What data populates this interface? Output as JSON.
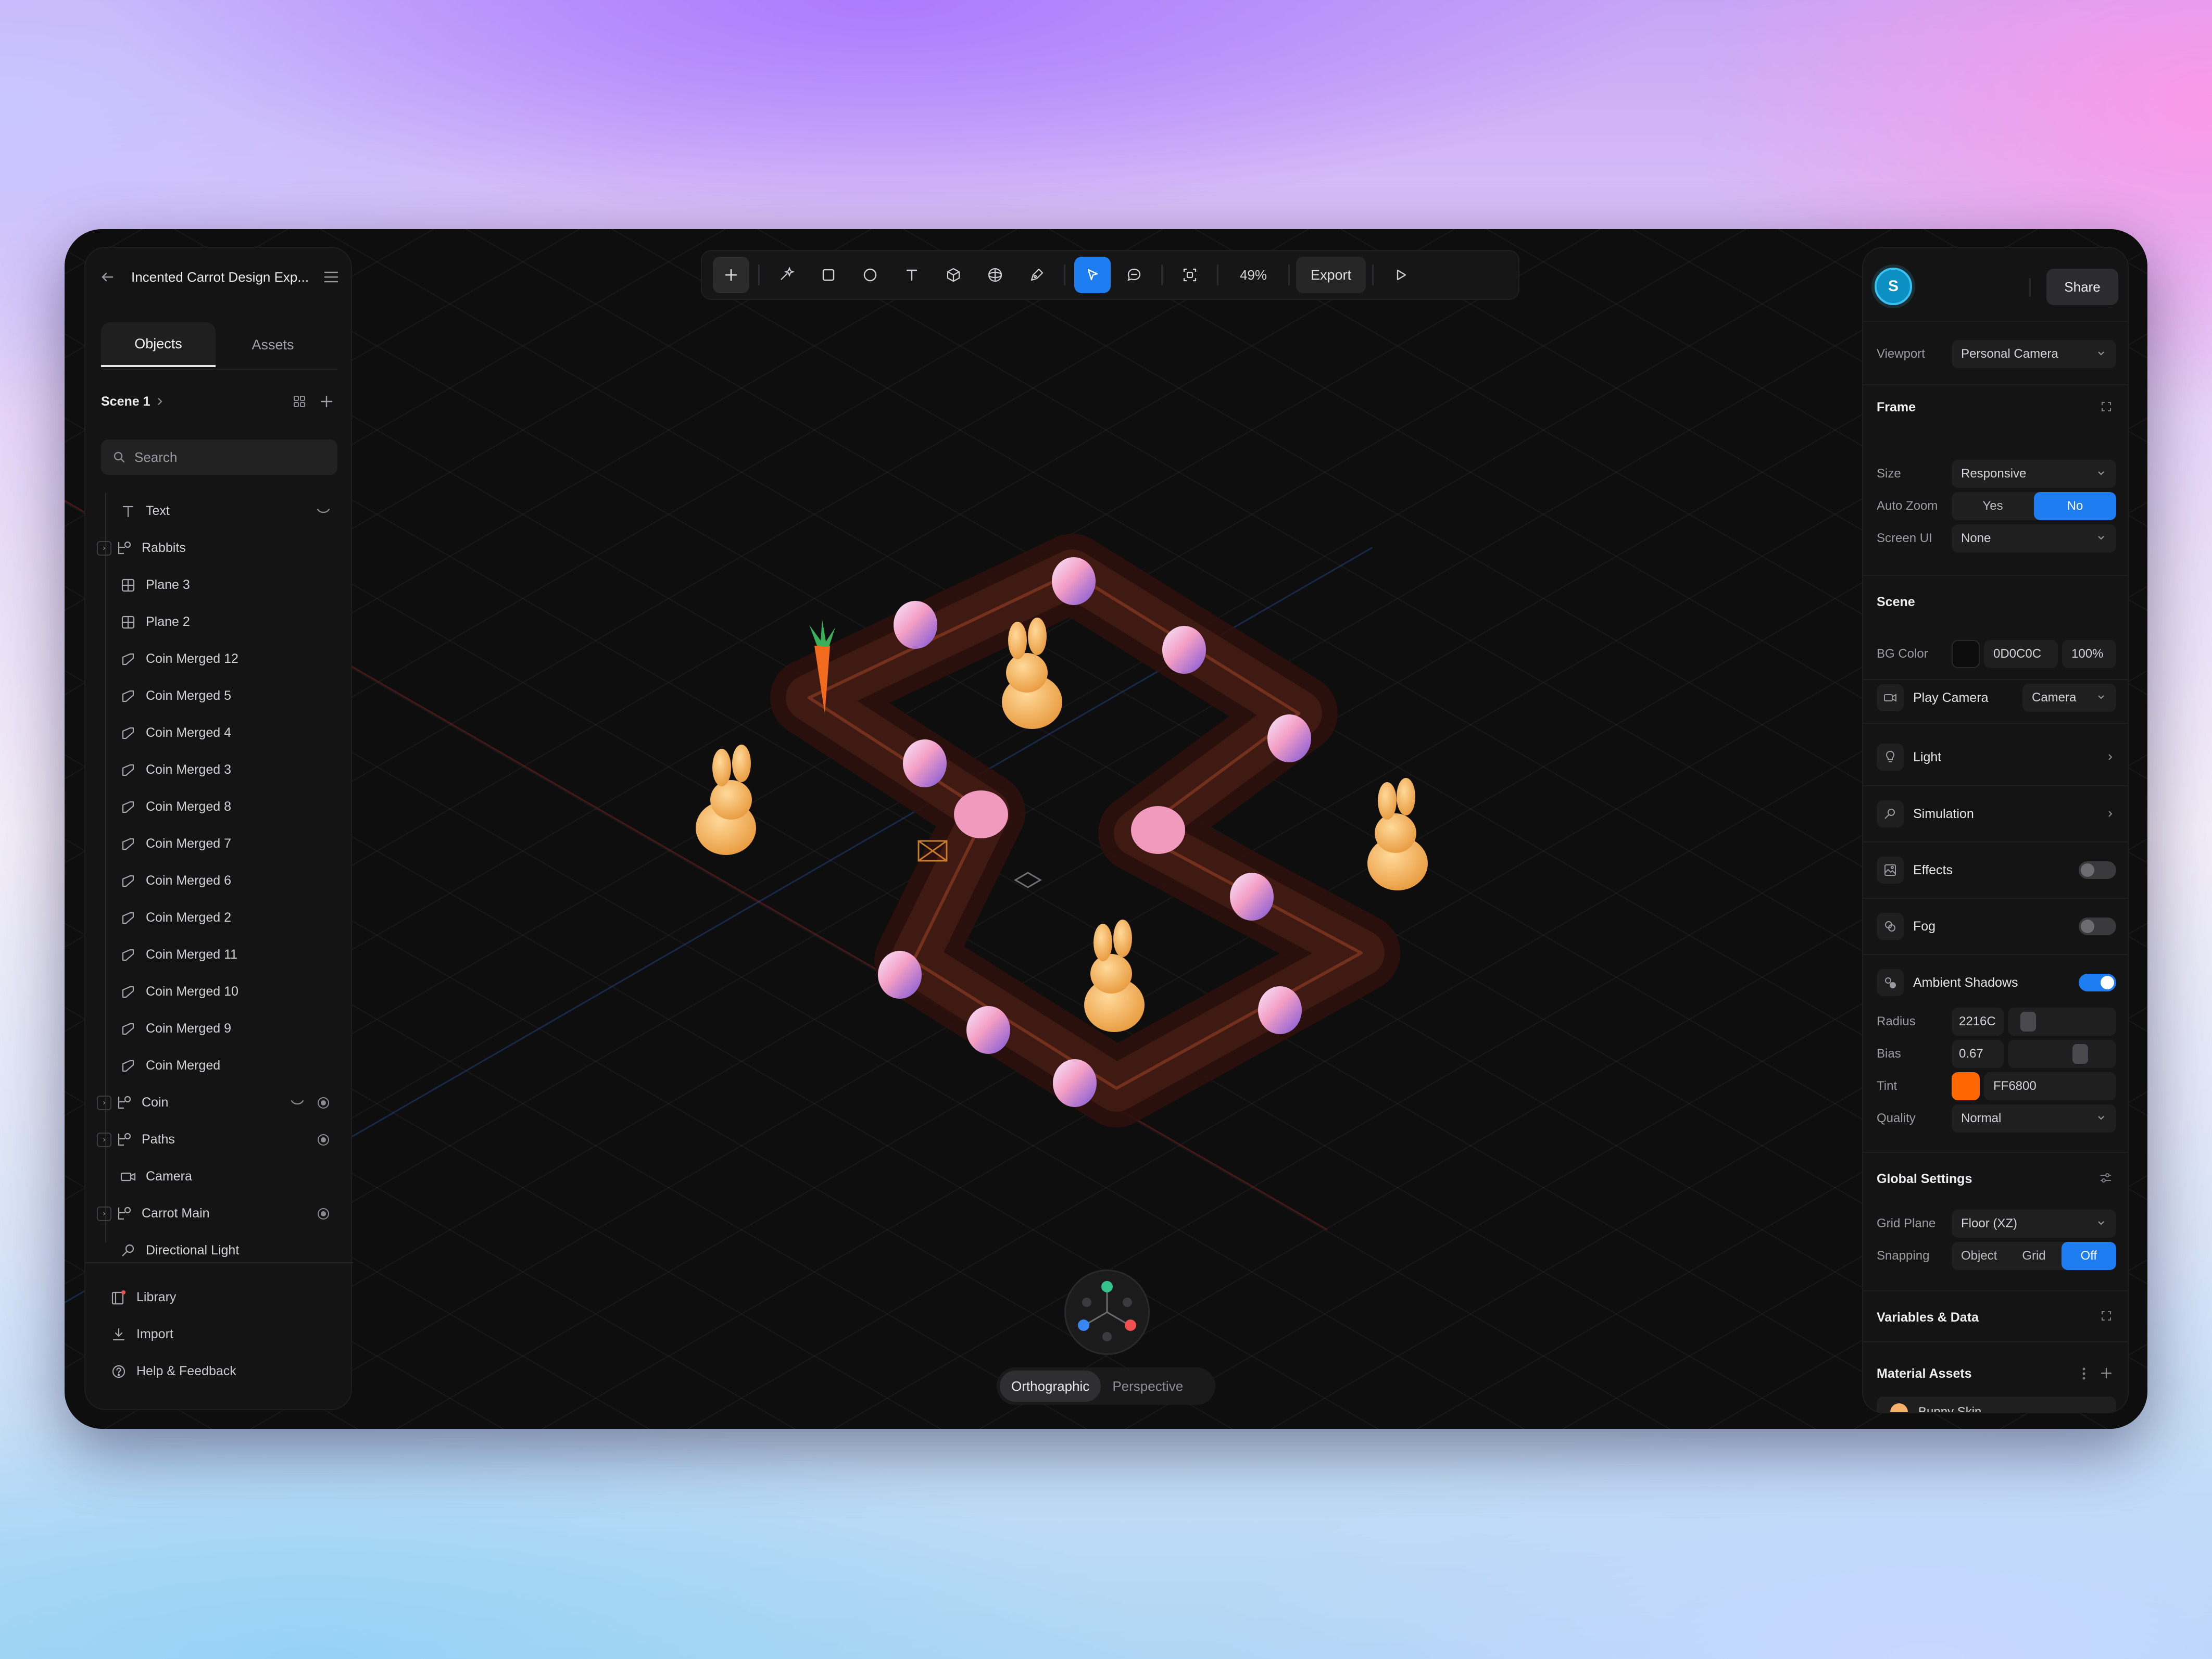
{
  "file": {
    "title": "Incented Carrot Design Exp..."
  },
  "left_panel": {
    "tabs": [
      {
        "label": "Objects"
      },
      {
        "label": "Assets"
      }
    ],
    "scene": {
      "label": "Scene 1"
    },
    "search": {
      "placeholder": "Search"
    },
    "tree": [
      {
        "label": "Text",
        "icon": "text-icon",
        "expandable": false
      },
      {
        "label": "Rabbits",
        "icon": "group-icon",
        "expandable": true
      },
      {
        "label": "Plane 3",
        "icon": "plane-icon",
        "expandable": false
      },
      {
        "label": "Plane 2",
        "icon": "plane-icon",
        "expandable": false
      },
      {
        "label": "Coin Merged 12",
        "icon": "mesh-icon",
        "expandable": false
      },
      {
        "label": "Coin Merged 5",
        "icon": "mesh-icon",
        "expandable": false
      },
      {
        "label": "Coin Merged 4",
        "icon": "mesh-icon",
        "expandable": false
      },
      {
        "label": "Coin Merged 3",
        "icon": "mesh-icon",
        "expandable": false
      },
      {
        "label": "Coin Merged 8",
        "icon": "mesh-icon",
        "expandable": false
      },
      {
        "label": "Coin Merged 7",
        "icon": "mesh-icon",
        "expandable": false
      },
      {
        "label": "Coin Merged 6",
        "icon": "mesh-icon",
        "expandable": false
      },
      {
        "label": "Coin Merged 2",
        "icon": "mesh-icon",
        "expandable": false
      },
      {
        "label": "Coin Merged 11",
        "icon": "mesh-icon",
        "expandable": false
      },
      {
        "label": "Coin Merged 10",
        "icon": "mesh-icon",
        "expandable": false
      },
      {
        "label": "Coin Merged 9",
        "icon": "mesh-icon",
        "expandable": false
      },
      {
        "label": "Coin Merged",
        "icon": "mesh-icon",
        "expandable": false
      },
      {
        "label": "Coin",
        "icon": "group-icon",
        "expandable": true
      },
      {
        "label": "Paths",
        "icon": "group-icon",
        "expandable": true
      },
      {
        "label": "Camera",
        "icon": "camera-icon",
        "expandable": false
      },
      {
        "label": "Carrot Main",
        "icon": "group-icon",
        "expandable": true
      },
      {
        "label": "Directional Light",
        "icon": "light-icon",
        "expandable": false
      }
    ],
    "footer": [
      {
        "label": "Library",
        "icon": "library-icon"
      },
      {
        "label": "Import",
        "icon": "import-icon"
      },
      {
        "label": "Help & Feedback",
        "icon": "help-icon"
      }
    ]
  },
  "toolbar": {
    "zoom": "49%",
    "export_label": "Export",
    "tools": [
      "add-icon",
      "ai-sparkle-icon",
      "rectangle-icon",
      "ellipse-icon",
      "text-tool-icon",
      "cube-icon",
      "sphere-icon",
      "pen-icon",
      "select-cursor-icon",
      "comment-icon",
      "frame-capture-icon",
      "play-icon"
    ]
  },
  "viewport": {
    "projection": [
      {
        "label": "Orthographic",
        "active": true
      },
      {
        "label": "Perspective",
        "active": false
      }
    ]
  },
  "right_panel": {
    "avatar_initial": "S",
    "share_label": "Share",
    "viewport": {
      "label": "Viewport",
      "value": "Personal Camera"
    },
    "frame": {
      "title": "Frame",
      "size_label": "Size",
      "size_value": "Responsive",
      "autozoom_label": "Auto Zoom",
      "autozoom_options": [
        "Yes",
        "No"
      ],
      "autozoom_selected": "No",
      "screenui_label": "Screen UI",
      "screenui_value": "None"
    },
    "scene": {
      "title": "Scene",
      "bg_label": "BG Color",
      "bg_hex": "0D0C0C",
      "bg_opacity": "100%",
      "bg_swatch": "#0D0C0C",
      "play_camera_label": "Play Camera",
      "play_camera_value": "Camera",
      "light_label": "Light",
      "simulation_label": "Simulation",
      "effects_label": "Effects",
      "effects_on": false,
      "fog_label": "Fog",
      "fog_on": false,
      "ambient_label": "Ambient Shadows",
      "ambient_on": true,
      "radius_label": "Radius",
      "radius_value": "2216C",
      "bias_label": "Bias",
      "bias_value": "0.67",
      "tint_label": "Tint",
      "tint_value": "FF6800",
      "tint_color": "#FF6800",
      "quality_label": "Quality",
      "quality_value": "Normal"
    },
    "global": {
      "title": "Global Settings",
      "grid_plane_label": "Grid Plane",
      "grid_plane_value": "Floor (XZ)",
      "snapping_label": "Snapping",
      "snapping_options": [
        "Object",
        "Grid",
        "Off"
      ],
      "snapping_selected": "Off"
    },
    "variables": {
      "title": "Variables & Data"
    },
    "materials": {
      "title": "Material Assets",
      "items": [
        {
          "label": "Bunny Skin",
          "color": "#F5B36A"
        }
      ]
    }
  },
  "colors": {
    "accent": "#1E7DF0",
    "bg": "#0D0C0C",
    "tint": "#FF6800"
  }
}
